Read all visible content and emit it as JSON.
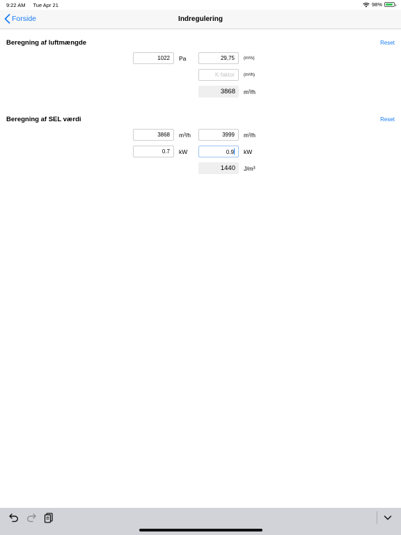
{
  "status": {
    "time": "9:22 AM",
    "date": "Tue Apr 21",
    "battery": "98%"
  },
  "nav": {
    "back_label": "Forside",
    "title": "Indregulering"
  },
  "section1": {
    "title": "Beregning af luftmængde",
    "reset_label": "Reset",
    "pressure_value": "1022",
    "pressure_unit": "Pa",
    "flow_value": "29,75",
    "flow_unit": "(m³/s)",
    "kfactor_placeholder": "K-faktor",
    "kfactor_unit": "(m³/h)",
    "result_value": "3868",
    "result_unit": "m³/h"
  },
  "section2": {
    "title": "Beregning af SEL værdi",
    "reset_label": "Reset",
    "flow1_value": "3868",
    "flow1_unit": "m³/h",
    "flow2_value": "3999",
    "flow2_unit": "m³/h",
    "power1_value": "0.7",
    "power1_unit": "kW",
    "power2_value": "0.9",
    "power2_unit": "kW",
    "result_value": "1440",
    "result_unit": "J/m³"
  },
  "toolbar": {
    "icons": [
      "undo-icon",
      "redo-icon",
      "paste-icon",
      "chevron-down-icon"
    ]
  }
}
